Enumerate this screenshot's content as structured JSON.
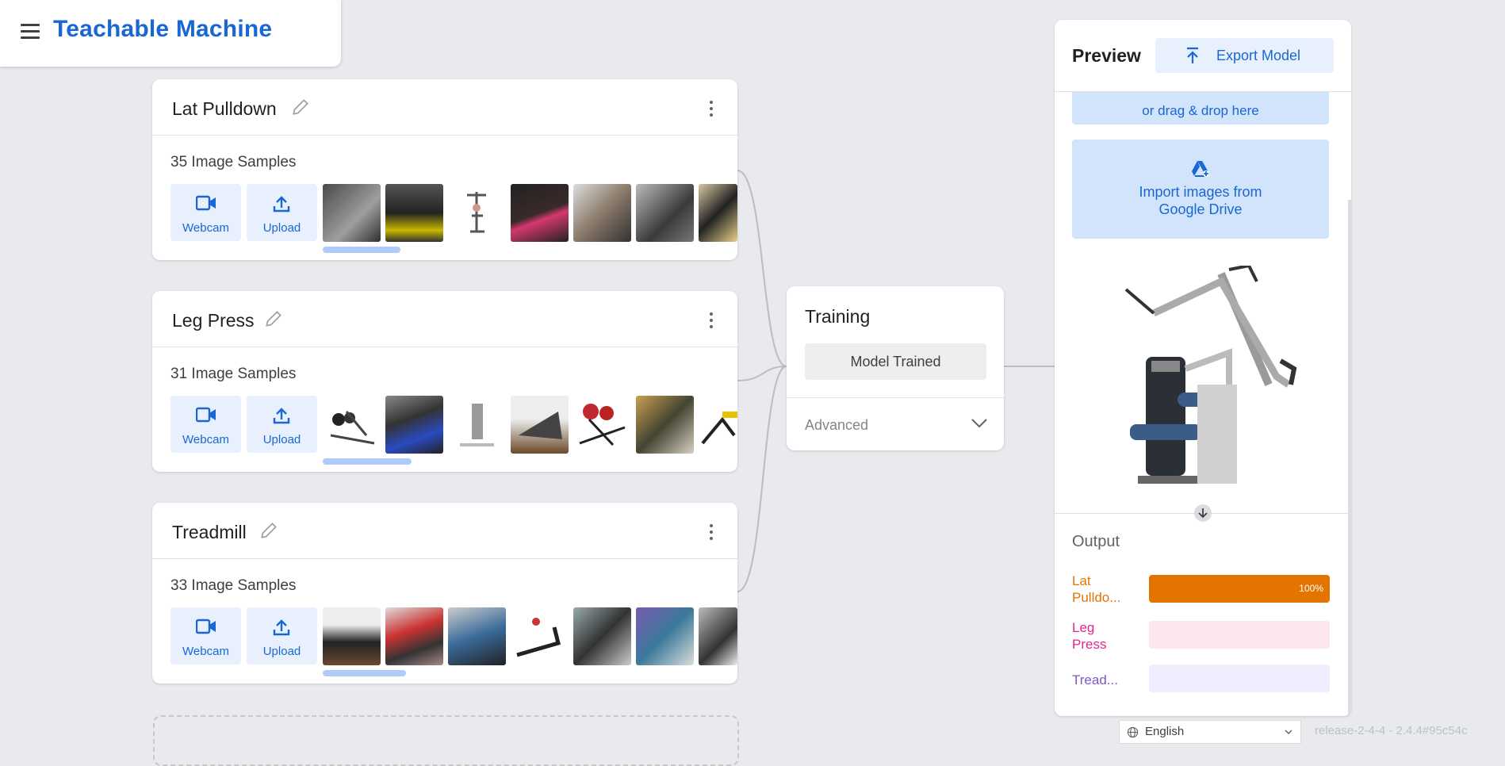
{
  "header": {
    "title": "Teachable Machine"
  },
  "classes": [
    {
      "name": "Lat Pulldown",
      "samples": "35 Image Samples",
      "webcam": "Webcam",
      "upload": "Upload"
    },
    {
      "name": "Leg Press",
      "samples": "31 Image Samples",
      "webcam": "Webcam",
      "upload": "Upload"
    },
    {
      "name": "Treadmill",
      "samples": "33 Image Samples",
      "webcam": "Webcam",
      "upload": "Upload"
    }
  ],
  "training": {
    "title": "Training",
    "button": "Model Trained",
    "advanced": "Advanced"
  },
  "preview": {
    "title": "Preview",
    "export": "Export Model",
    "drop": "or drag & drop here",
    "drive_line1": "Import images from",
    "drive_line2": "Google Drive",
    "output_title": "Output",
    "outputs": [
      {
        "label1": "Lat",
        "label2": "Pulldo...",
        "percent": 100,
        "percent_text": "100%",
        "color": "#e37400",
        "track": "#fce8e6"
      },
      {
        "label1": "Leg",
        "label2": "Press",
        "percent": 0,
        "percent_text": "",
        "color": "#e52592",
        "track": "#fde7ec"
      },
      {
        "label1": "Tread...",
        "label2": "",
        "percent": 0,
        "percent_text": "",
        "color": "#7e57c2",
        "track": "#efeefe"
      }
    ]
  },
  "footer": {
    "language": "English",
    "version": "release-2-4-4 - 2.4.4#95c54c"
  },
  "colors": {
    "accent": "#1967d2",
    "background": "#e8eaed"
  }
}
